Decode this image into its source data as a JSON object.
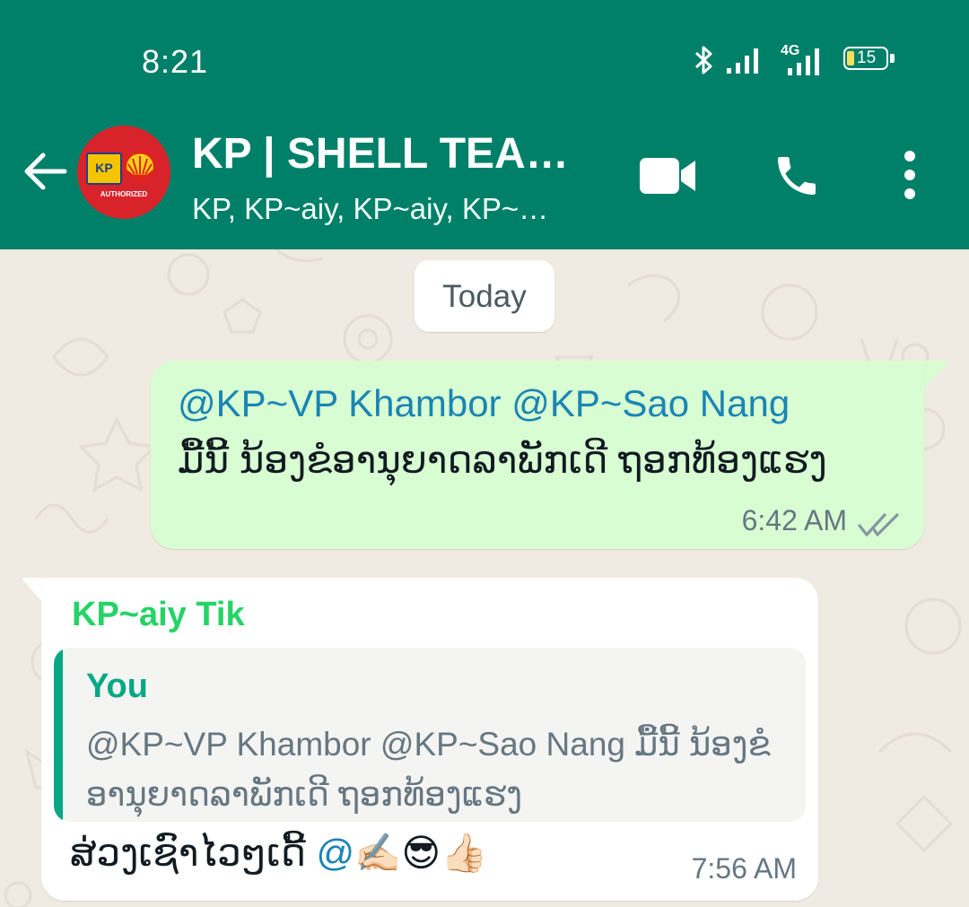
{
  "status_bar": {
    "time": "8:21",
    "network": "4G",
    "battery": "15",
    "icons": [
      "bluetooth-icon",
      "signal-icon",
      "signal-4g-icon",
      "battery-icon"
    ]
  },
  "header": {
    "title": "KP | SHELL TEA…",
    "subtitle": "KP, KP~aiy, KP~aiy, KP~…",
    "avatar_badge": "KP",
    "avatar_caption": "AUTHORIZED"
  },
  "colors": {
    "header_green": "#008069",
    "outgoing_bubble": "#d9fdd3",
    "mention_blue": "#1a85b4",
    "sender_green": "#25d366",
    "quote_accent": "#06a884"
  },
  "chat": {
    "date_label": "Today",
    "messages": [
      {
        "direction": "outgoing",
        "mentions": "@KP~VP Khambor @KP~Sao Nang",
        "text": "ມື້ນີ້ ນ້ອງຂໍອານຸຍາດລາພັກເດີ ຖອກທ້ອງແຮງ",
        "time": "6:42 AM",
        "status": "read"
      },
      {
        "direction": "incoming",
        "sender": "KP~aiy Tik",
        "quoted": {
          "author": "You",
          "text": "@KP~VP Khambor @KP~Sao Nang ມື້ນີ້ ນ້ອງຂໍອານຸຍາດລາພັກເດີ ຖອກທ້ອງແຮງ"
        },
        "text": "ສ່ວງເຊົາໄວໆເດີ້ ",
        "mention": "@",
        "emoji": "✍🏻😎👍🏻",
        "time": "7:56 AM"
      }
    ]
  }
}
